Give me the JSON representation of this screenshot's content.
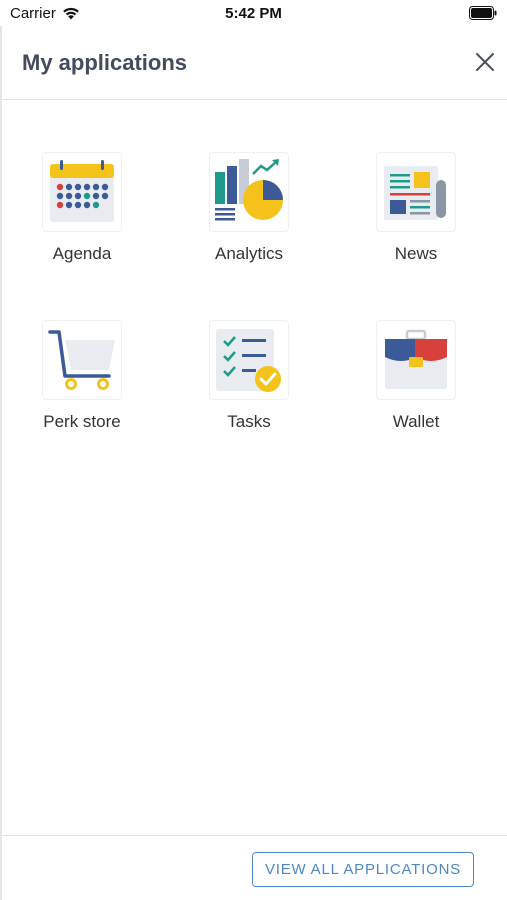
{
  "status_bar": {
    "carrier": "Carrier",
    "time": "5:42 PM"
  },
  "header": {
    "title": "My applications",
    "close_icon": "close-icon"
  },
  "apps": [
    {
      "label": "Agenda",
      "icon": "calendar-icon"
    },
    {
      "label": "Analytics",
      "icon": "analytics-icon"
    },
    {
      "label": "News",
      "icon": "newspaper-icon"
    },
    {
      "label": "Perk store",
      "icon": "cart-icon"
    },
    {
      "label": "Tasks",
      "icon": "tasks-icon"
    },
    {
      "label": "Wallet",
      "icon": "wallet-icon"
    }
  ],
  "footer": {
    "view_all_label": "VIEW ALL APPLICATIONS"
  },
  "colors": {
    "accent": "#4f86c6",
    "title": "#454b5e",
    "yellow": "#f5c21b",
    "navy": "#3d5a98",
    "teal": "#1f9a8a",
    "red": "#d8403c"
  }
}
